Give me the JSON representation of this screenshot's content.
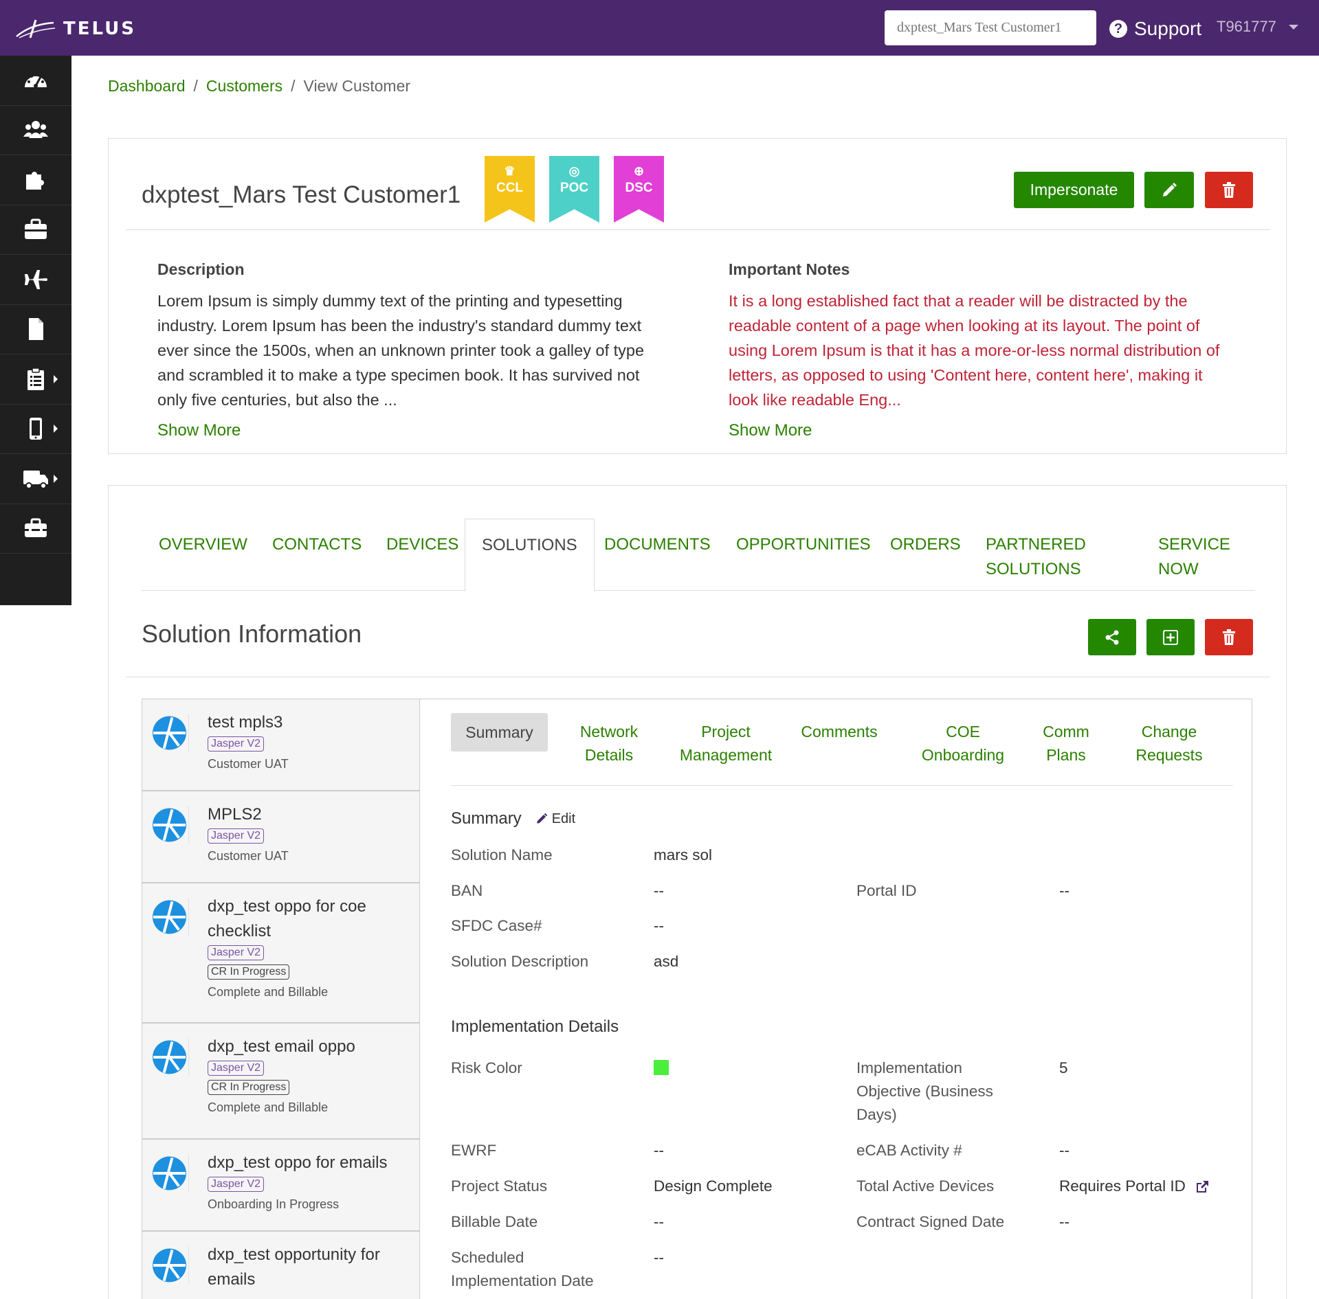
{
  "header": {
    "logo_text": "TELUS",
    "customer_search_placeholder": "dxptest_Mars Test Customer1",
    "support_label": "Support",
    "user_id": "T961777"
  },
  "sidebar": {
    "items": [
      {
        "icon": "dashboard-icon"
      },
      {
        "icon": "users-icon"
      },
      {
        "icon": "puzzle-icon"
      },
      {
        "icon": "briefcase-icon"
      },
      {
        "icon": "plane-icon"
      },
      {
        "icon": "file-icon"
      },
      {
        "icon": "clipboard-icon",
        "has_submenu": true
      },
      {
        "icon": "mobile-icon",
        "has_submenu": true
      },
      {
        "icon": "truck-icon",
        "has_submenu": true
      },
      {
        "icon": "toolbox-icon"
      }
    ]
  },
  "breadcrumb": {
    "items": [
      "Dashboard",
      "Customers"
    ],
    "current": "View Customer",
    "separator": "/"
  },
  "customer": {
    "name": "dxptest_Mars Test Customer1",
    "badges": [
      {
        "label": "CCL",
        "color": "#f5c41a",
        "icon": "crown-icon"
      },
      {
        "label": "POC",
        "color": "#4dd0c8",
        "icon": "target-icon"
      },
      {
        "label": "DSC",
        "color": "#e23fd6",
        "icon": "globe-icon"
      }
    ],
    "impersonate_label": "Impersonate",
    "description_label": "Description",
    "description_lines": [
      "Lorem Ipsum is simply dummy text of the printing and typesetting",
      "industry. Lorem Ipsum has been the industry's standard dummy text",
      "ever since the 1500s, when an unknown printer took a galley of type",
      "and scrambled it to make a type specimen book. It has survived not",
      "only five centuries, but also the ..."
    ],
    "notes_label": "Important Notes",
    "notes_lines": [
      "It is a long established fact that a reader will be distracted by the",
      "readable content of a page when looking at its layout. The point of",
      "using Lorem Ipsum is that it has a more-or-less normal distribution of",
      "letters, as opposed to using 'Content here, content here', making it",
      "look like readable Eng..."
    ],
    "show_more": "Show More"
  },
  "tabs": [
    {
      "label": "OVERVIEW"
    },
    {
      "label": "CONTACTS"
    },
    {
      "label": "DEVICES"
    },
    {
      "label": "SOLUTIONS",
      "active": true
    },
    {
      "label": "DOCUMENTS"
    },
    {
      "label": "OPPORTUNITIES"
    },
    {
      "label": "ORDERS"
    },
    {
      "label": "PARTNERED",
      "label2": "SOLUTIONS"
    },
    {
      "label": "SERVICE",
      "label2": "NOW"
    }
  ],
  "solution_info_title": "Solution Information",
  "solutions": [
    {
      "name_lines": [
        "test mpls3"
      ],
      "tags": [
        {
          "text": "Jasper V2",
          "style": "purple"
        }
      ],
      "status": "Customer UAT"
    },
    {
      "name_lines": [
        "MPLS2"
      ],
      "tags": [
        {
          "text": "Jasper V2",
          "style": "purple"
        }
      ],
      "status": "Customer UAT"
    },
    {
      "name_lines": [
        "dxp_test oppo for coe",
        "checklist"
      ],
      "tags": [
        {
          "text": "Jasper V2",
          "style": "purple"
        },
        {
          "text": "CR In Progress",
          "style": "grey"
        }
      ],
      "status": "Complete and Billable"
    },
    {
      "name_lines": [
        "dxp_test email oppo"
      ],
      "tags": [
        {
          "text": "Jasper V2",
          "style": "purple"
        },
        {
          "text": "CR In Progress",
          "style": "grey"
        }
      ],
      "status": "Complete and Billable"
    },
    {
      "name_lines": [
        "dxp_test oppo for emails"
      ],
      "tags": [
        {
          "text": "Jasper V2",
          "style": "purple"
        }
      ],
      "status": "Onboarding In Progress"
    },
    {
      "name_lines": [
        "dxp_test opportunity for",
        "emails"
      ],
      "tags": [],
      "status": ""
    }
  ],
  "subtabs": [
    {
      "label": "Summary",
      "active": true
    },
    {
      "label": "Network",
      "label2": "Details"
    },
    {
      "label": "Project",
      "label2": "Management"
    },
    {
      "label": "Comments"
    },
    {
      "label": "COE",
      "label2": "Onboarding"
    },
    {
      "label": "Comm",
      "label2": "Plans"
    },
    {
      "label": "Change",
      "label2": "Requests"
    }
  ],
  "summary": {
    "heading": "Summary",
    "edit_label": "Edit",
    "solution_name_label": "Solution Name",
    "solution_name": "mars sol",
    "ban_label": "BAN",
    "ban": "--",
    "portal_id_label": "Portal ID",
    "portal_id": "--",
    "sfdc_label": "SFDC Case#",
    "sfdc": "--",
    "desc_label": "Solution Description",
    "desc": "asd"
  },
  "implementation": {
    "heading": "Implementation Details",
    "risk_label": "Risk Color",
    "risk_color": "#4cee3e",
    "objective_label_lines": [
      "Implementation",
      "Objective (Business",
      "Days)"
    ],
    "objective": "5",
    "ewrf_label": "EWRF",
    "ewrf": "--",
    "ecab_label": "eCAB Activity #",
    "ecab": "--",
    "project_status_label": "Project Status",
    "project_status": "Design Complete",
    "total_devices_label": "Total Active Devices",
    "total_devices": "Requires Portal ID",
    "billable_label": "Billable Date",
    "billable": "--",
    "contract_label": "Contract Signed Date",
    "contract": "--",
    "scheduled_label_lines": [
      "Scheduled",
      "Implementation Date"
    ],
    "scheduled": "--"
  }
}
